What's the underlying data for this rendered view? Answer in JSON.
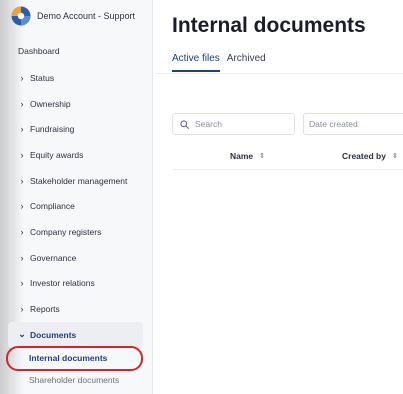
{
  "sidebar": {
    "account_name": "Demo Account - Support",
    "dashboard_label": "Dashboard",
    "items": [
      {
        "label": "Status",
        "icon": "chevron-right-icon"
      },
      {
        "label": "Ownership",
        "icon": "chevron-right-icon"
      },
      {
        "label": "Fundraising",
        "icon": "chevron-right-icon"
      },
      {
        "label": "Equity awards",
        "icon": "chevron-right-icon"
      },
      {
        "label": "Stakeholder management",
        "icon": "chevron-right-icon"
      },
      {
        "label": "Compliance",
        "icon": "chevron-right-icon"
      },
      {
        "label": "Company registers",
        "icon": "chevron-right-icon"
      },
      {
        "label": "Governance",
        "icon": "chevron-right-icon"
      },
      {
        "label": "Investor relations",
        "icon": "chevron-right-icon"
      },
      {
        "label": "Reports",
        "icon": "chevron-right-icon"
      },
      {
        "label": "Documents",
        "icon": "chevron-down-icon",
        "expanded": true
      }
    ],
    "sub_items": [
      {
        "label": "Internal documents",
        "active": true
      },
      {
        "label": "Shareholder documents",
        "active": false
      }
    ]
  },
  "main": {
    "title": "Internal documents",
    "tabs": [
      {
        "label": "Active files",
        "active": true
      },
      {
        "label": "Archived",
        "active": false
      }
    ],
    "search": {
      "placeholder": "Search"
    },
    "date_filter": {
      "placeholder": "Date created"
    },
    "columns": [
      {
        "label": "Name"
      },
      {
        "label": "Created by"
      }
    ]
  },
  "colors": {
    "accent": "#1f3e86",
    "highlight_ring": "#d8232a",
    "sidebar_bg": "#f7f8fa",
    "logo_orange": "#f0a23a",
    "logo_blue": "#2a5fa8"
  }
}
